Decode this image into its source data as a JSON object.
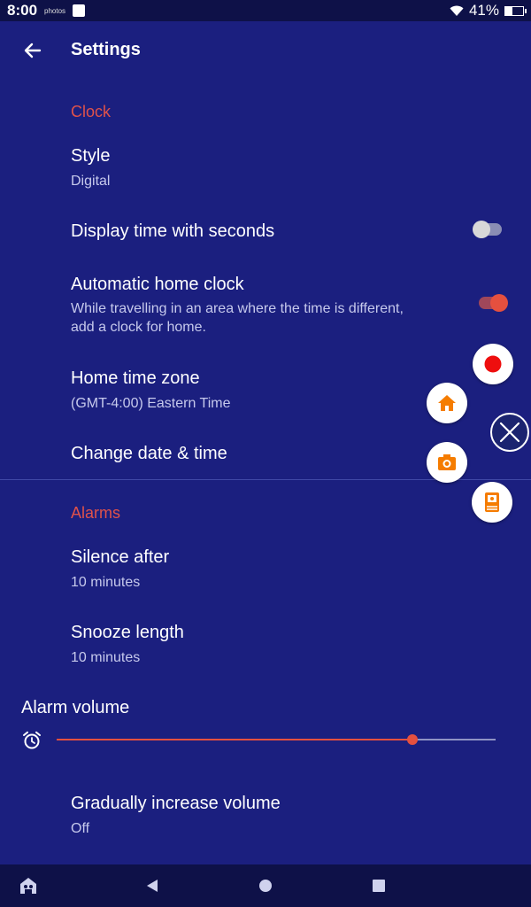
{
  "status": {
    "time": "8:00",
    "notif_label": "photos",
    "battery": "41%",
    "battery_level": 0.41
  },
  "header": {
    "title": "Settings"
  },
  "clock": {
    "section_label": "Clock",
    "style": {
      "title": "Style",
      "value": "Digital"
    },
    "seconds": {
      "title": "Display time with seconds",
      "enabled": false
    },
    "auto_home": {
      "title": "Automatic home clock",
      "description_line1": "While travelling in an area where the time is different,",
      "description_line2": "add a clock for home.",
      "enabled": true
    },
    "home_tz": {
      "title": "Home time zone",
      "value": "(GMT-4:00) Eastern Time"
    },
    "change_dt": {
      "title": "Change date & time"
    }
  },
  "alarms": {
    "section_label": "Alarms",
    "silence": {
      "title": "Silence after",
      "value": "10 minutes"
    },
    "snooze": {
      "title": "Snooze length",
      "value": "10 minutes"
    },
    "volume": {
      "title": "Alarm volume",
      "level": 0.81
    },
    "gradual": {
      "title": "Gradually increase volume",
      "value": "Off"
    }
  },
  "icons": {
    "back": "arrow-left-icon",
    "record": "record-icon",
    "home": "home-icon",
    "camera": "camera-icon",
    "document": "document-icon",
    "close": "close-icon",
    "alarm": "alarm-clock-icon"
  },
  "colors": {
    "background": "#1b1f7f",
    "accent": "#e5503f",
    "fab_orange": "#f57c00"
  }
}
